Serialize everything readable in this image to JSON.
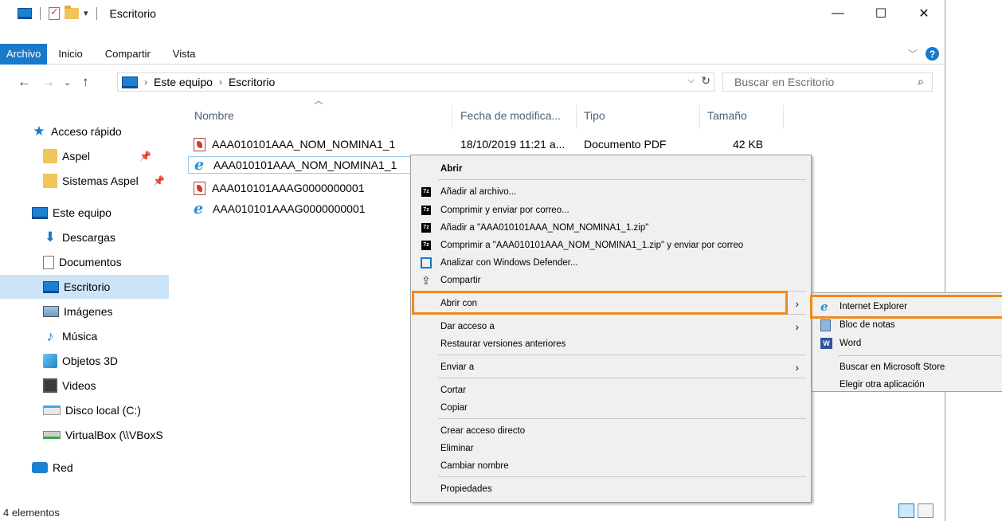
{
  "window": {
    "title": "Escritorio",
    "controls": {
      "minimize": "—",
      "maximize": "☐",
      "close": "✕"
    }
  },
  "ribbon": {
    "tabs": [
      "Archivo",
      "Inicio",
      "Compartir",
      "Vista"
    ],
    "active_tab": "Archivo",
    "help": "?"
  },
  "address": {
    "crumbs": [
      "Este equipo",
      "Escritorio"
    ],
    "search_placeholder": "Buscar en Escritorio"
  },
  "sidebar": {
    "quick_access": "Acceso rápido",
    "pinned": [
      "Aspel",
      "Sistemas Aspel"
    ],
    "this_pc": "Este equipo",
    "items": [
      "Descargas",
      "Documentos",
      "Escritorio",
      "Imágenes",
      "Música",
      "Objetos 3D",
      "Videos",
      "Disco local (C:)",
      "VirtualBox (\\\\VBoxS"
    ],
    "network": "Red",
    "selected": "Escritorio"
  },
  "columns": {
    "name": "Nombre",
    "modified": "Fecha de modifica...",
    "type": "Tipo",
    "size": "Tamaño"
  },
  "files": [
    {
      "name": "AAA010101AAA_NOM_NOMINA1_1",
      "icon": "pdf-icon",
      "modified": "18/10/2019 11:21 a...",
      "type": "Documento PDF",
      "size": "42 KB"
    },
    {
      "name": "AAA010101AAA_NOM_NOMINA1_1",
      "icon": "ie-icon"
    },
    {
      "name": "AAA010101AAAG0000000001",
      "icon": "pdf-icon"
    },
    {
      "name": "AAA010101AAAG0000000001",
      "icon": "ie-icon"
    }
  ],
  "status": {
    "count": "4 elementos"
  },
  "context_menu": {
    "open": "Abrir",
    "add_archive": "Añadir al archivo...",
    "compress_email": "Comprimir y enviar por correo...",
    "add_zip": "Añadir a \"AAA010101AAA_NOM_NOMINA1_1.zip\"",
    "compress_zip_email": "Comprimir a \"AAA010101AAA_NOM_NOMINA1_1.zip\" y enviar por correo",
    "defender": "Analizar con Windows Defender...",
    "share": "Compartir",
    "open_with": "Abrir con",
    "give_access": "Dar acceso a",
    "restore": "Restaurar versiones anteriores",
    "send_to": "Enviar a",
    "cut": "Cortar",
    "copy": "Copiar",
    "create_shortcut": "Crear acceso directo",
    "delete": "Eliminar",
    "rename": "Cambiar nombre",
    "properties": "Propiedades"
  },
  "open_with_submenu": {
    "apps": [
      "Internet Explorer",
      "Bloc de notas",
      "Word"
    ],
    "store": "Buscar en Microsoft Store",
    "other": "Elegir otra aplicación"
  },
  "colors": {
    "accent": "#1979ca",
    "highlight": "#f08a1c",
    "selection": "#cce4f7"
  }
}
